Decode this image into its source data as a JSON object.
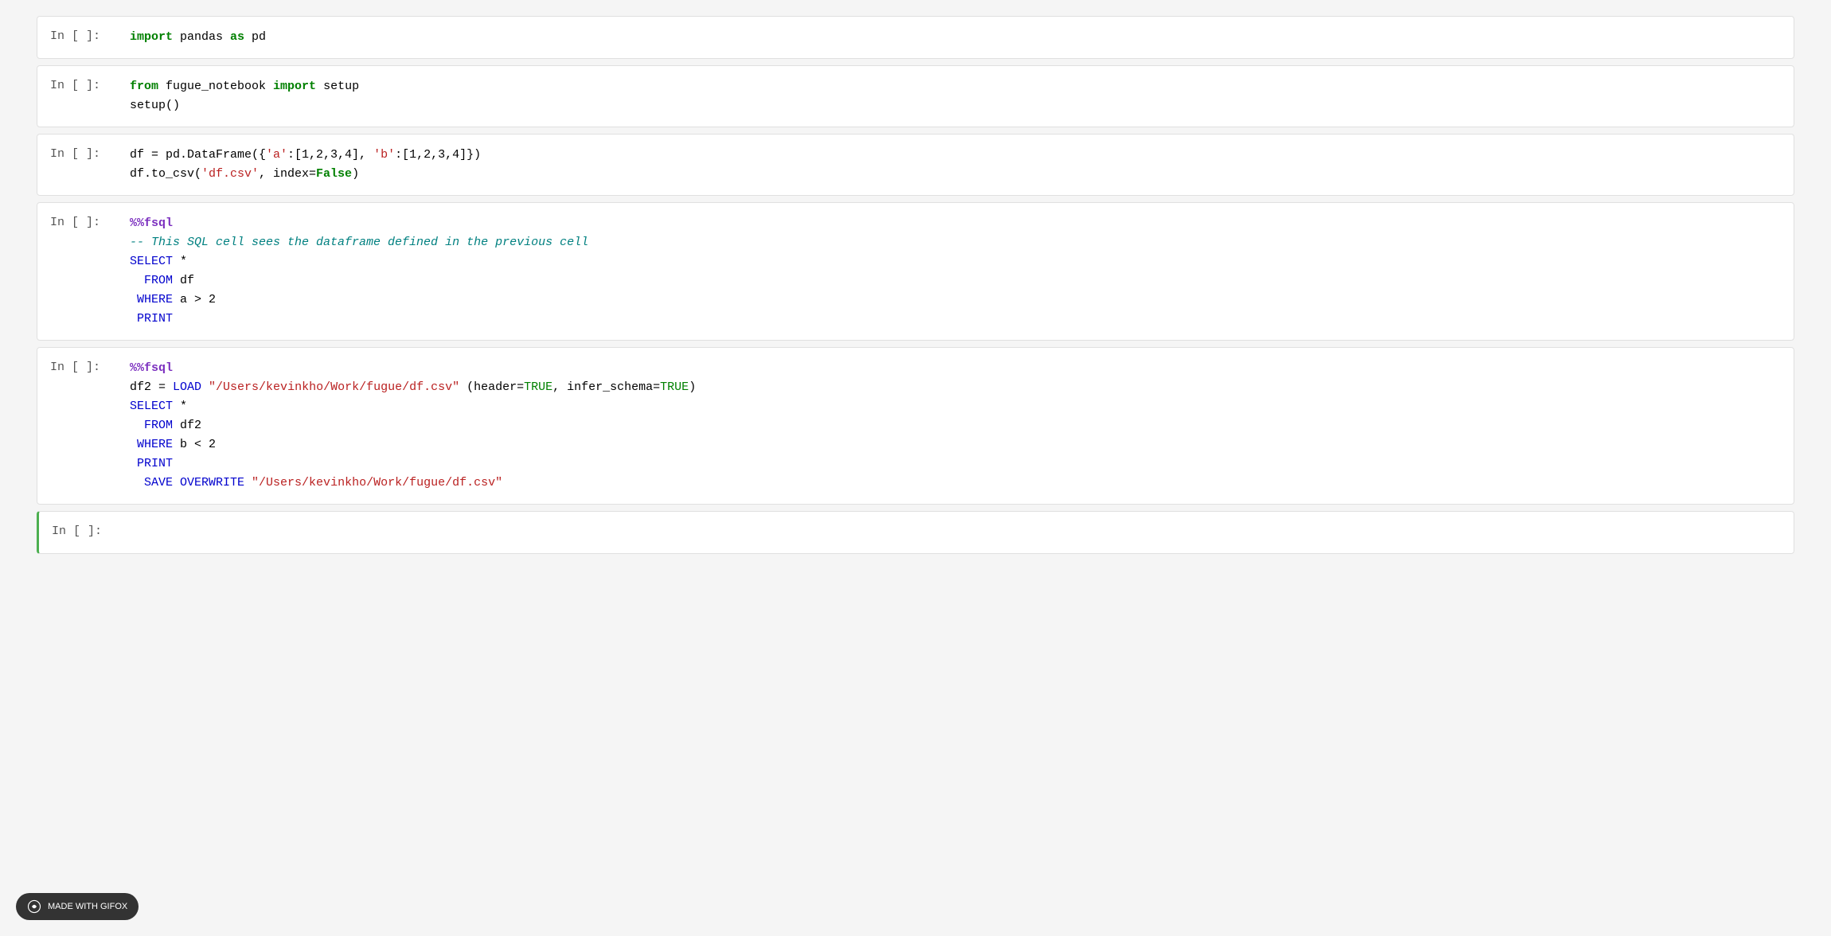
{
  "cells": [
    {
      "id": "cell-1",
      "prompt": "In [ ]:",
      "lines": [
        {
          "parts": [
            {
              "text": "import",
              "class": "kw-green"
            },
            {
              "text": " pandas ",
              "class": "plain"
            },
            {
              "text": "as",
              "class": "kw-green"
            },
            {
              "text": " pd",
              "class": "plain"
            }
          ]
        }
      ],
      "active": false
    },
    {
      "id": "cell-2",
      "prompt": "In [ ]:",
      "lines": [
        {
          "parts": [
            {
              "text": "from",
              "class": "kw-green"
            },
            {
              "text": " fugue_notebook ",
              "class": "plain"
            },
            {
              "text": "import",
              "class": "kw-green"
            },
            {
              "text": " setup",
              "class": "plain"
            }
          ]
        },
        {
          "parts": [
            {
              "text": "setup()",
              "class": "plain"
            }
          ]
        }
      ],
      "active": false
    },
    {
      "id": "cell-3",
      "prompt": "In [ ]:",
      "lines": [
        {
          "parts": [
            {
              "text": "df = pd.DataFrame({",
              "class": "plain"
            },
            {
              "text": "'a'",
              "class": "str-red"
            },
            {
              "text": ":[1,2,3,4], ",
              "class": "plain"
            },
            {
              "text": "'b'",
              "class": "str-red"
            },
            {
              "text": ":[1,2,3,4]})",
              "class": "plain"
            }
          ]
        },
        {
          "parts": [
            {
              "text": "df.to_csv(",
              "class": "plain"
            },
            {
              "text": "'df.csv'",
              "class": "str-red"
            },
            {
              "text": ", index=",
              "class": "plain"
            },
            {
              "text": "False",
              "class": "kw-green"
            },
            {
              "text": ")",
              "class": "plain"
            }
          ]
        }
      ],
      "active": false
    },
    {
      "id": "cell-4",
      "prompt": "In [ ]:",
      "lines": [
        {
          "parts": [
            {
              "text": "%%fsql",
              "class": "magic"
            }
          ]
        },
        {
          "parts": [
            {
              "text": "-- This SQL cell sees the dataframe defined in the previous cell",
              "class": "comment-teal"
            }
          ]
        },
        {
          "parts": [
            {
              "text": "SELECT",
              "class": "kw-blue"
            },
            {
              "text": " *",
              "class": "plain"
            }
          ]
        },
        {
          "parts": [
            {
              "text": "  FROM",
              "class": "kw-blue"
            },
            {
              "text": " df",
              "class": "plain"
            }
          ]
        },
        {
          "parts": [
            {
              "text": " WHERE",
              "class": "kw-blue"
            },
            {
              "text": " a > 2",
              "class": "plain"
            }
          ]
        },
        {
          "parts": [
            {
              "text": " PRINT",
              "class": "kw-blue"
            }
          ]
        }
      ],
      "active": false
    },
    {
      "id": "cell-5",
      "prompt": "In [ ]:",
      "lines": [
        {
          "parts": [
            {
              "text": "%%fsql",
              "class": "magic"
            }
          ]
        },
        {
          "parts": [
            {
              "text": "df2 = ",
              "class": "plain"
            },
            {
              "text": "LOAD",
              "class": "kw-blue"
            },
            {
              "text": " ",
              "class": "plain"
            },
            {
              "text": "\"/Users/kevinkho/Work/fugue/df.csv\"",
              "class": "str-red"
            },
            {
              "text": " (header=",
              "class": "plain"
            },
            {
              "text": "TRUE",
              "class": "val-green"
            },
            {
              "text": ", infer_schema=",
              "class": "plain"
            },
            {
              "text": "TRUE",
              "class": "val-green"
            },
            {
              "text": ")",
              "class": "plain"
            }
          ]
        },
        {
          "parts": [
            {
              "text": "SELECT",
              "class": "kw-blue"
            },
            {
              "text": " *",
              "class": "plain"
            }
          ]
        },
        {
          "parts": [
            {
              "text": "  FROM",
              "class": "kw-blue"
            },
            {
              "text": " df2",
              "class": "plain"
            }
          ]
        },
        {
          "parts": [
            {
              "text": " WHERE",
              "class": "kw-blue"
            },
            {
              "text": " b < 2",
              "class": "plain"
            }
          ]
        },
        {
          "parts": [
            {
              "text": " PRINT",
              "class": "kw-blue"
            }
          ]
        },
        {
          "parts": [
            {
              "text": "  SAVE OVERWRITE",
              "class": "kw-blue"
            },
            {
              "text": " ",
              "class": "plain"
            },
            {
              "text": "\"/Users/kevinkho/Work/fugue/df.csv\"",
              "class": "str-red"
            }
          ]
        }
      ],
      "active": false
    },
    {
      "id": "cell-6",
      "prompt": "In [ ]:",
      "lines": [],
      "active": true
    }
  ],
  "bottom_bar": {
    "label": "MADE WITH GIFOX"
  }
}
